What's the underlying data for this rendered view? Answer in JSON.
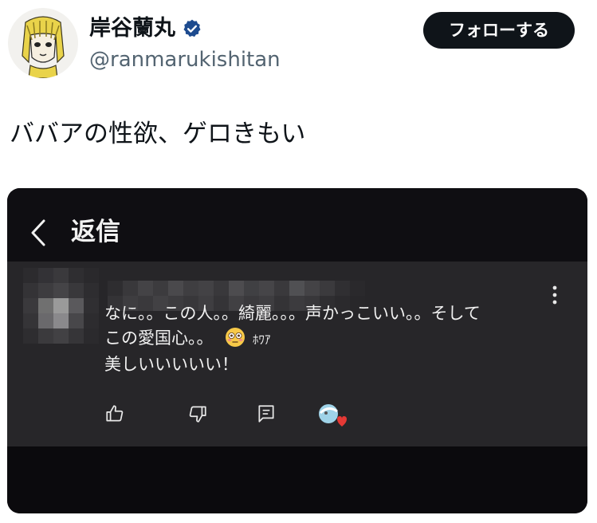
{
  "user": {
    "display_name": "岸谷蘭丸",
    "handle": "@ranmarukishitan",
    "avatar_icon": "cartoon-girl-avatar-icon",
    "verified_icon": "verified-badge-icon",
    "verified_color": "#1d9bf0"
  },
  "follow_button": {
    "label": "フォローする"
  },
  "tweet": {
    "text": "ババアの性欲、ゲロきもい"
  },
  "media": {
    "header": {
      "back_icon": "chevron-left-icon",
      "title": "返信"
    },
    "comment": {
      "line1": "なに。。この人。。綺麗。。。声かっこいい。。そして",
      "line2": "この愛国心。。",
      "line2_emoji_icon": "flushed-face-emoji-icon",
      "line2_suffix": "ﾎﾜｱ",
      "line3": "美しいいいいい！",
      "menu_icon": "more-vertical-icon"
    },
    "actions": [
      "like-icon",
      "dislike-icon",
      "reply-icon",
      "creator-heart-icon"
    ]
  }
}
